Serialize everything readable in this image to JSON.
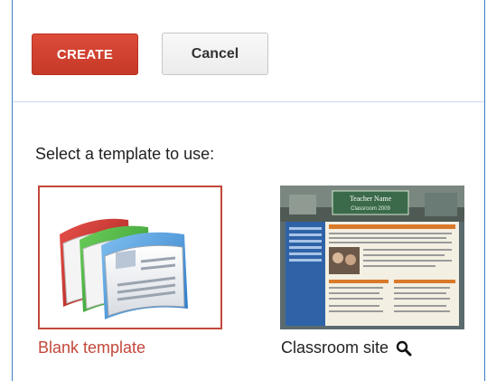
{
  "toolbar": {
    "create_label": "CREATE",
    "cancel_label": "Cancel"
  },
  "prompt": "Select a template to use:",
  "templates": [
    {
      "label": "Blank template",
      "selected": true,
      "icon": "stacked-pages-icon"
    },
    {
      "label": "Classroom site",
      "selected": false,
      "preview_title": "Teacher Name",
      "preview_subtitle": "Classroom 2009",
      "action_icon": "magnifier-icon"
    }
  ],
  "colors": {
    "create_bg": "#dd4b39",
    "selected_border": "#c3483b",
    "frame_border": "#3f7fc4"
  }
}
